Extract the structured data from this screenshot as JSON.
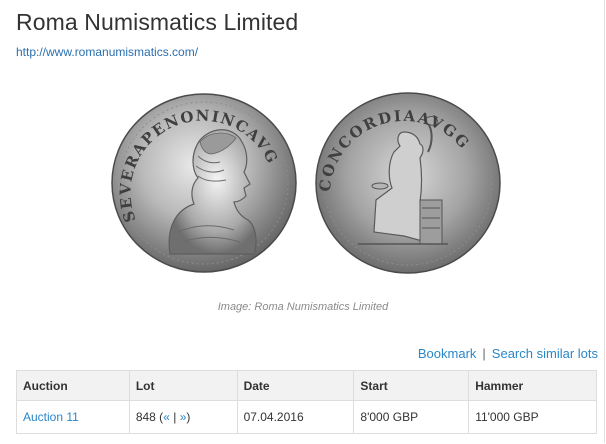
{
  "header": {
    "title": "Roma Numismatics Limited",
    "site_url": "http://www.romanumismatics.com/"
  },
  "coin": {
    "obverse_legend": "SEVERAPENONINCAVG",
    "reverse_legend": "CONCORDIAAVGG",
    "caption": "Image: Roma Numismatics Limited"
  },
  "actions": {
    "bookmark_label": "Bookmark",
    "separator": "|",
    "search_label": "Search similar lots"
  },
  "table": {
    "headers": [
      "Auction",
      "Lot",
      "Date",
      "Start",
      "Hammer"
    ],
    "rows": [
      {
        "auction": "Auction 11",
        "lot_number": "848",
        "lot_prev": "«",
        "lot_sep": "|",
        "lot_next": "»",
        "date": "07.04.2016",
        "start": "8'000 GBP",
        "hammer": "11'000 GBP"
      }
    ]
  }
}
